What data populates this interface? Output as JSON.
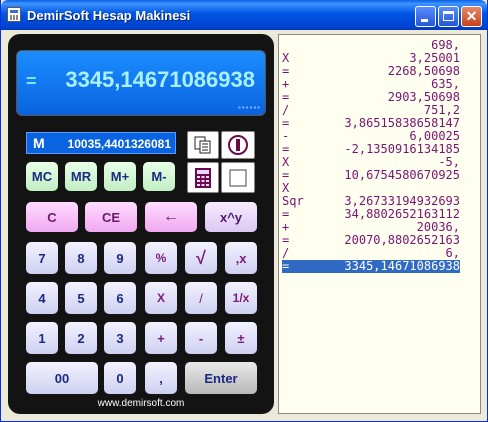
{
  "window": {
    "title": "DemirSoft Hesap Makinesi"
  },
  "display": {
    "eq": "=",
    "value": "3345,1467108693​8"
  },
  "memory": {
    "label": "M",
    "value": "10035,4401326081"
  },
  "buttons": {
    "mc": "MC",
    "mr": "MR",
    "mplus": "M+",
    "mminus": "M-",
    "c": "C",
    "ce": "CE",
    "backspace": "←",
    "power": "x^y",
    "n7": "7",
    "n8": "8",
    "n9": "9",
    "percent": "%",
    "sqrt": "√",
    "rev_x": ",x",
    "n4": "4",
    "n5": "5",
    "n6": "6",
    "mult": "X",
    "div": "/",
    "inv": "1/x",
    "n1": "1",
    "n2": "2",
    "n3": "3",
    "plus": "+",
    "minus": "-",
    "sign": "±",
    "n00": "00",
    "n0": "0",
    "comma": ",",
    "enter": "Enter"
  },
  "footer": "www.demirsoft.com",
  "tape": [
    {
      "op": "",
      "num": "698,"
    },
    {
      "op": "X",
      "num": "3,25001"
    },
    {
      "op": "=",
      "num": "2268,50698"
    },
    {
      "op": "+",
      "num": "635,"
    },
    {
      "op": "=",
      "num": "2903,50698"
    },
    {
      "op": "/",
      "num": "751,2"
    },
    {
      "op": "=",
      "num": "3,86515838658147"
    },
    {
      "op": "-",
      "num": "6,00025"
    },
    {
      "op": "=",
      "num": "-2,1350916134185"
    },
    {
      "op": "X",
      "num": "-5,"
    },
    {
      "op": "=",
      "num": "10,6754580670925"
    },
    {
      "op": "X",
      "num": ""
    },
    {
      "op": "Sqr",
      "num": "3,26733194932693"
    },
    {
      "op": "=",
      "num": "34,8802652163112"
    },
    {
      "op": "+",
      "num": "20036,"
    },
    {
      "op": "=",
      "num": "20070,8802652163"
    },
    {
      "op": "/",
      "num": "6,"
    },
    {
      "op": "=",
      "num": "3345,1467108693​8"
    }
  ],
  "colors": {
    "tape_text": "#7a1470",
    "display_bg": "#0a63e0",
    "selection": "#316AC5"
  }
}
